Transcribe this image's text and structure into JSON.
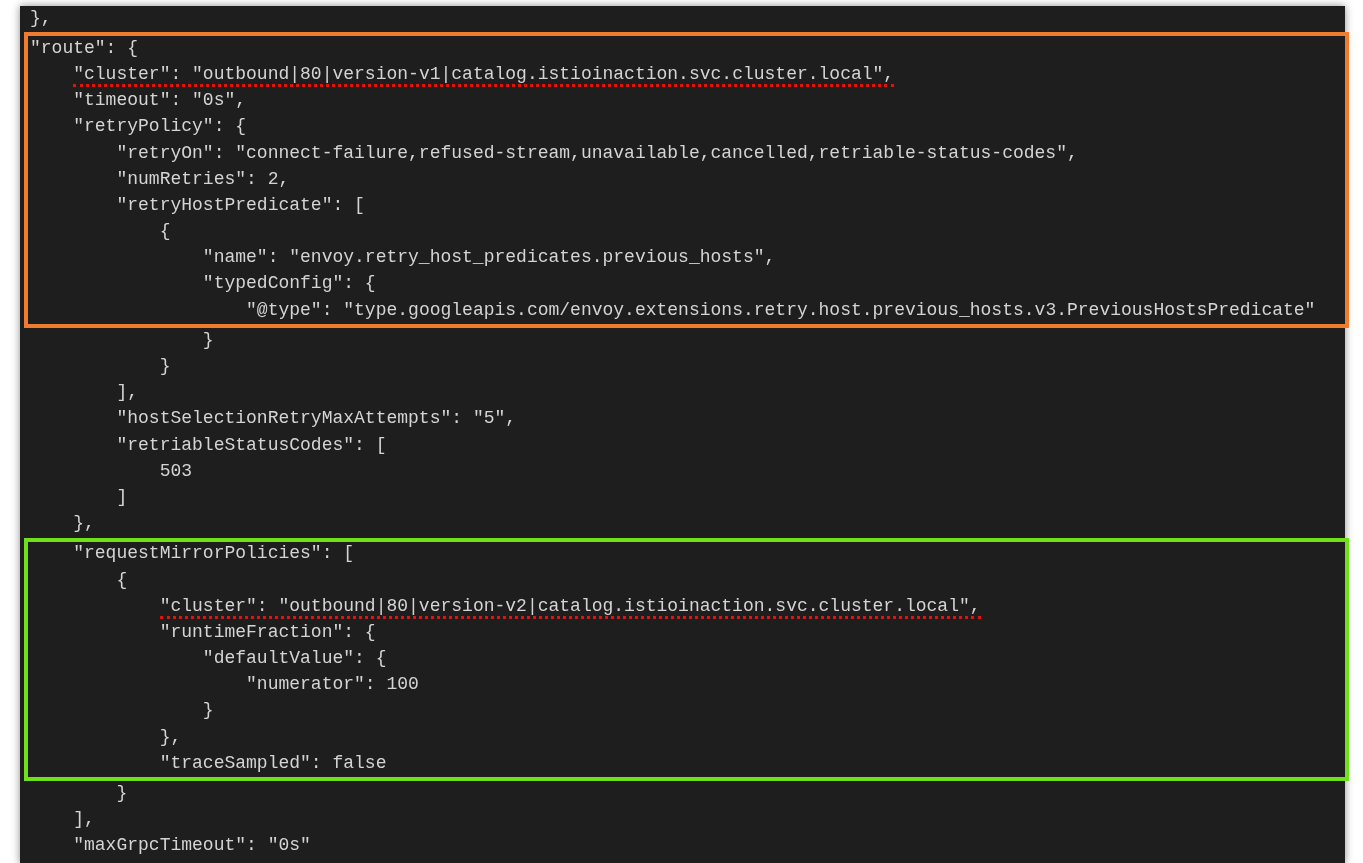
{
  "blocks": [
    {
      "kind": "plain",
      "lines": [
        {
          "text": "},",
          "underlined": false
        }
      ]
    },
    {
      "kind": "outlined",
      "color": "#f07d2e",
      "lines": [
        {
          "text": "\"route\": {",
          "underlined": false
        },
        {
          "text": "    \"cluster\": \"outbound|80|version-v1|catalog.istioinaction.svc.cluster.local\",",
          "underlined": true
        },
        {
          "text": "    \"timeout\": \"0s\",",
          "underlined": false
        },
        {
          "text": "    \"retryPolicy\": {",
          "underlined": false
        },
        {
          "text": "        \"retryOn\": \"connect-failure,refused-stream,unavailable,cancelled,retriable-status-codes\",",
          "underlined": false
        },
        {
          "text": "        \"numRetries\": 2,",
          "underlined": false
        },
        {
          "text": "        \"retryHostPredicate\": [",
          "underlined": false
        },
        {
          "text": "            {",
          "underlined": false
        },
        {
          "text": "                \"name\": \"envoy.retry_host_predicates.previous_hosts\",",
          "underlined": false
        },
        {
          "text": "                \"typedConfig\": {",
          "underlined": false
        },
        {
          "text": "                    \"@type\": \"type.googleapis.com/envoy.extensions.retry.host.previous_hosts.v3.PreviousHostsPredicate\"",
          "underlined": false
        }
      ]
    },
    {
      "kind": "plain",
      "lines": [
        {
          "text": "                }",
          "underlined": false
        },
        {
          "text": "            }",
          "underlined": false
        },
        {
          "text": "        ],",
          "underlined": false
        },
        {
          "text": "        \"hostSelectionRetryMaxAttempts\": \"5\",",
          "underlined": false
        },
        {
          "text": "        \"retriableStatusCodes\": [",
          "underlined": false
        },
        {
          "text": "            503",
          "underlined": false
        },
        {
          "text": "        ]",
          "underlined": false
        },
        {
          "text": "    },",
          "underlined": false
        }
      ]
    },
    {
      "kind": "outlined",
      "color": "#6ee01c",
      "lines": [
        {
          "text": "    \"requestMirrorPolicies\": [",
          "underlined": false
        },
        {
          "text": "        {",
          "underlined": false
        },
        {
          "text": "            \"cluster\": \"outbound|80|version-v2|catalog.istioinaction.svc.cluster.local\",",
          "underlined": true
        },
        {
          "text": "            \"runtimeFraction\": {",
          "underlined": false
        },
        {
          "text": "                \"defaultValue\": {",
          "underlined": false
        },
        {
          "text": "                    \"numerator\": 100",
          "underlined": false
        },
        {
          "text": "                }",
          "underlined": false
        },
        {
          "text": "            },",
          "underlined": false
        },
        {
          "text": "            \"traceSampled\": false",
          "underlined": false
        }
      ]
    },
    {
      "kind": "plain",
      "lines": [
        {
          "text": "        }",
          "underlined": false
        },
        {
          "text": "    ],",
          "underlined": false
        },
        {
          "text": "    \"maxGrpcTimeout\": \"0s\"",
          "underlined": false
        }
      ]
    }
  ]
}
